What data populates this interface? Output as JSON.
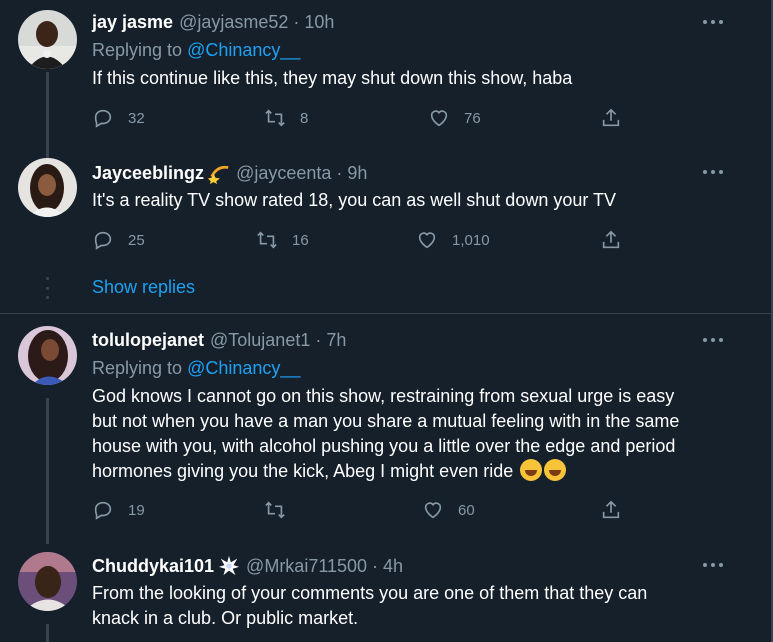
{
  "tweets": [
    {
      "name": "jay jasme",
      "handle": "@jayjasme52 · 10h",
      "replying_label": "Replying to",
      "replying_to": "@Chinancy__",
      "text": "If this continue like this, they may shut  down this show, haba",
      "replies": "32",
      "retweets": "8",
      "likes": "76"
    },
    {
      "name": "Jayceeblingz",
      "badge_icon": "dizzy-icon",
      "handle": "@jayceenta · 9h",
      "text": "It's a reality TV show rated 18, you can as well shut down your TV",
      "replies": "25",
      "retweets": "16",
      "likes": "1,010"
    },
    {
      "name": "tolulopejanet",
      "handle": "@Tolujanet1 · 7h",
      "replying_label": "Replying to",
      "replying_to": "@Chinancy__",
      "text_lines": [
        "God knows I cannot go on this show, restraining from sexual urge is easy",
        "but not when you have a man you share a mutual feeling with  in the same",
        "house with you, with alcohol pushing you a little over the edge and period",
        "hormones giving you the kick, Abeg I might even ride"
      ],
      "emoji_icon": "rolling-laughing-icon",
      "replies": "19",
      "retweets": "",
      "likes": "60"
    },
    {
      "name": "Chuddykai101",
      "badge_icon": "collision-icon",
      "handle": "@Mrkai711500 · 4h",
      "text_lines": [
        "From the looking of your comments you are one of them that they can",
        "knack in a club. Or public market."
      ]
    }
  ],
  "show_replies": "Show replies",
  "colors": {
    "background": "#15202b",
    "secondary_text": "#8899a6",
    "link": "#1da1f2",
    "divider": "#38444d"
  }
}
